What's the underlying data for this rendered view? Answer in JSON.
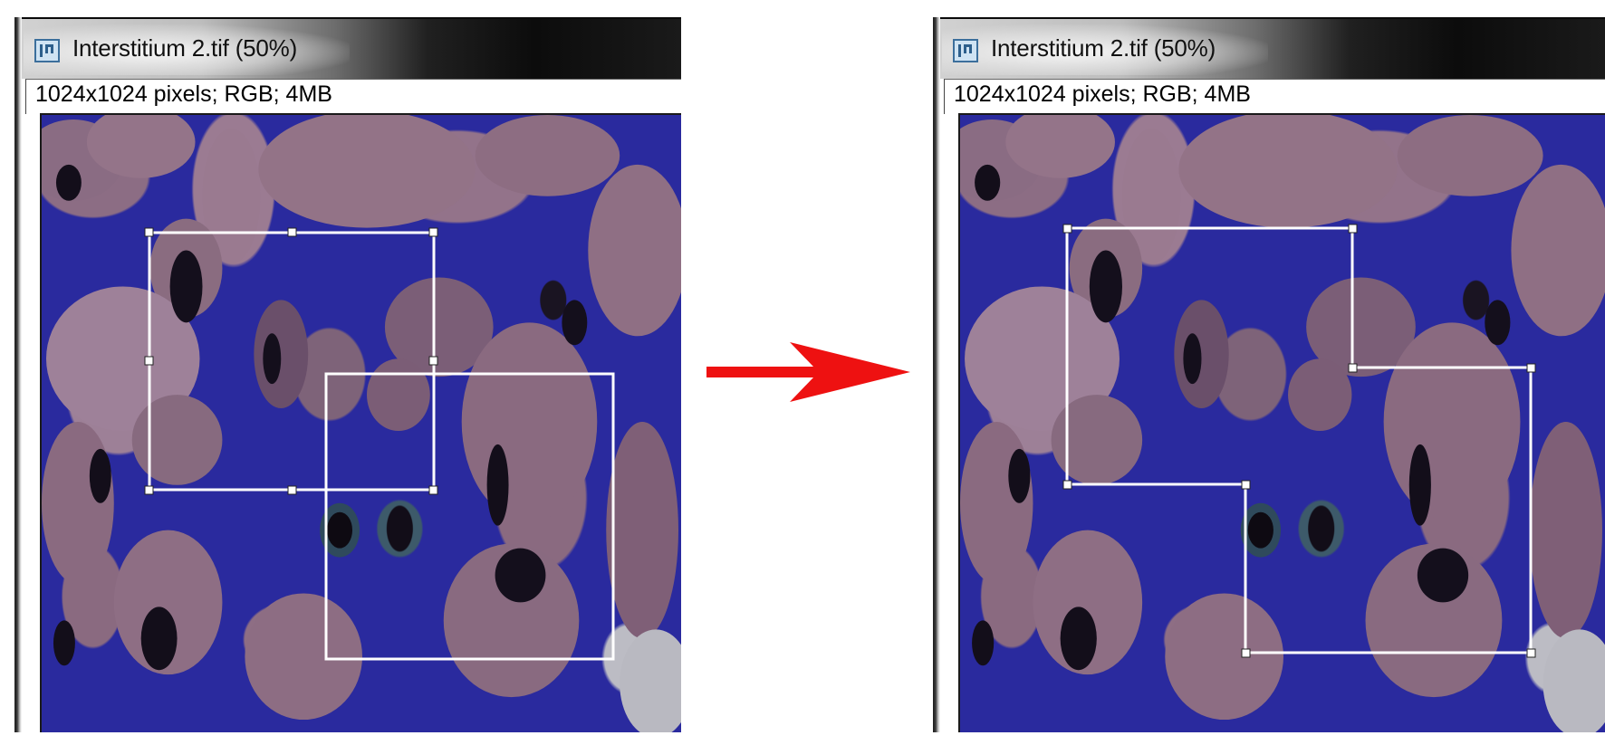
{
  "windows": [
    {
      "title": "Interstitium 2.tif (50%)",
      "info": "1024x1024 pixels; RGB; 4MB",
      "icon": "imagej-icon"
    },
    {
      "title": "Interstitium 2.tif (50%)",
      "info": "1024x1024 pixels; RGB; 4MB",
      "icon": "imagej-icon"
    }
  ],
  "colors": {
    "arrow": "#ee1111",
    "roi": "#ffffff",
    "tissue_blue": "#2a2a9e",
    "tissue_pink": "#9b7b92"
  },
  "annotations": {
    "left_roi": "two overlapping rectangle selections",
    "right_roi": "combined composite selection",
    "arrow": "red arrow pointing right"
  }
}
